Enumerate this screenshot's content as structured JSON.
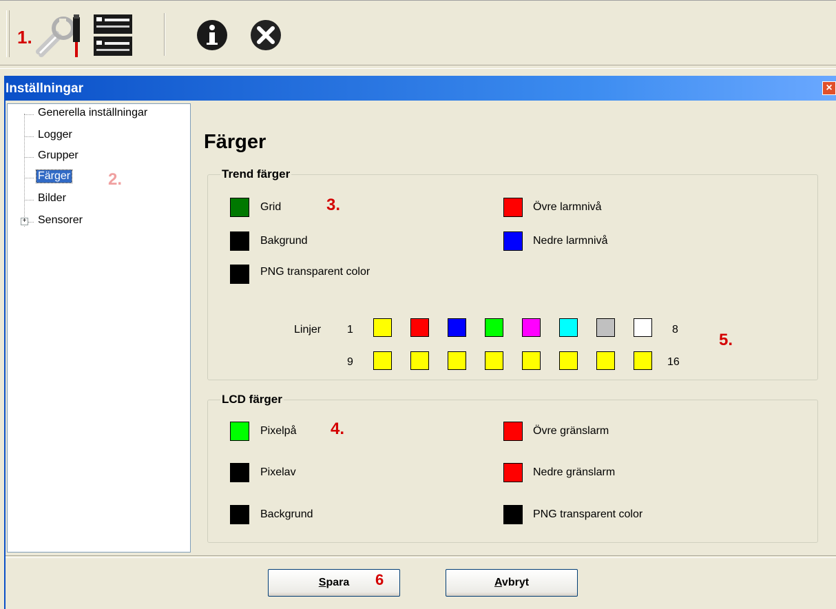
{
  "toolbar": {
    "marker": "1.",
    "icons": [
      "settings-wrench-icon",
      "devices-icon",
      "info-icon",
      "close-circle-icon"
    ]
  },
  "window": {
    "title": "Inställningar",
    "close": "×"
  },
  "tree": {
    "items": [
      {
        "label": "Generella inställningar"
      },
      {
        "label": "Logger"
      },
      {
        "label": "Grupper"
      },
      {
        "label": "Färger",
        "selected": true
      },
      {
        "label": "Bilder"
      },
      {
        "label": "Sensorer",
        "expander": "+"
      }
    ],
    "marker": "2."
  },
  "page": {
    "title": "Färger"
  },
  "trend": {
    "group_title": "Trend färger",
    "marker": "3.",
    "items": [
      {
        "label": "Grid",
        "color": "#007800"
      },
      {
        "label": "Bakgrund",
        "color": "#000000"
      },
      {
        "label": "PNG transparent color",
        "color": "#000000"
      },
      {
        "label": "Övre larmnivå",
        "color": "#ff0000"
      },
      {
        "label": "Nedre larmnivå",
        "color": "#0000ff"
      }
    ],
    "lines": {
      "label": "Linjer",
      "row1_start": "1",
      "row1_end": "8",
      "row2_start": "9",
      "row2_end": "16",
      "row1_colors": [
        "#ffff00",
        "#ff0000",
        "#0000ff",
        "#00ff00",
        "#ff00ff",
        "#00ffff",
        "#c0c0c0",
        "#ffffff"
      ],
      "row2_colors": [
        "#ffff00",
        "#ffff00",
        "#ffff00",
        "#ffff00",
        "#ffff00",
        "#ffff00",
        "#ffff00",
        "#ffff00"
      ]
    },
    "lines_marker": "5."
  },
  "lcd": {
    "group_title": "LCD färger",
    "marker": "4.",
    "items": [
      {
        "label": "Pixelpå",
        "color": "#00ff00"
      },
      {
        "label": "Pixelav",
        "color": "#000000"
      },
      {
        "label": "Backgrund",
        "color": "#000000"
      },
      {
        "label": "Övre gränslarm",
        "color": "#ff0000"
      },
      {
        "label": "Nedre gränslarm",
        "color": "#ff0000"
      },
      {
        "label": "PNG transparent color",
        "color": "#000000"
      }
    ]
  },
  "buttons": {
    "save_mnemonic": "S",
    "save_rest": "para",
    "save_marker": "6",
    "cancel_mnemonic": "A",
    "cancel_rest": "vbryt"
  },
  "colors": {
    "marker_red": "#d40000",
    "marker_pink": "#f0a0a0",
    "title_blue": "#0a50c8"
  }
}
